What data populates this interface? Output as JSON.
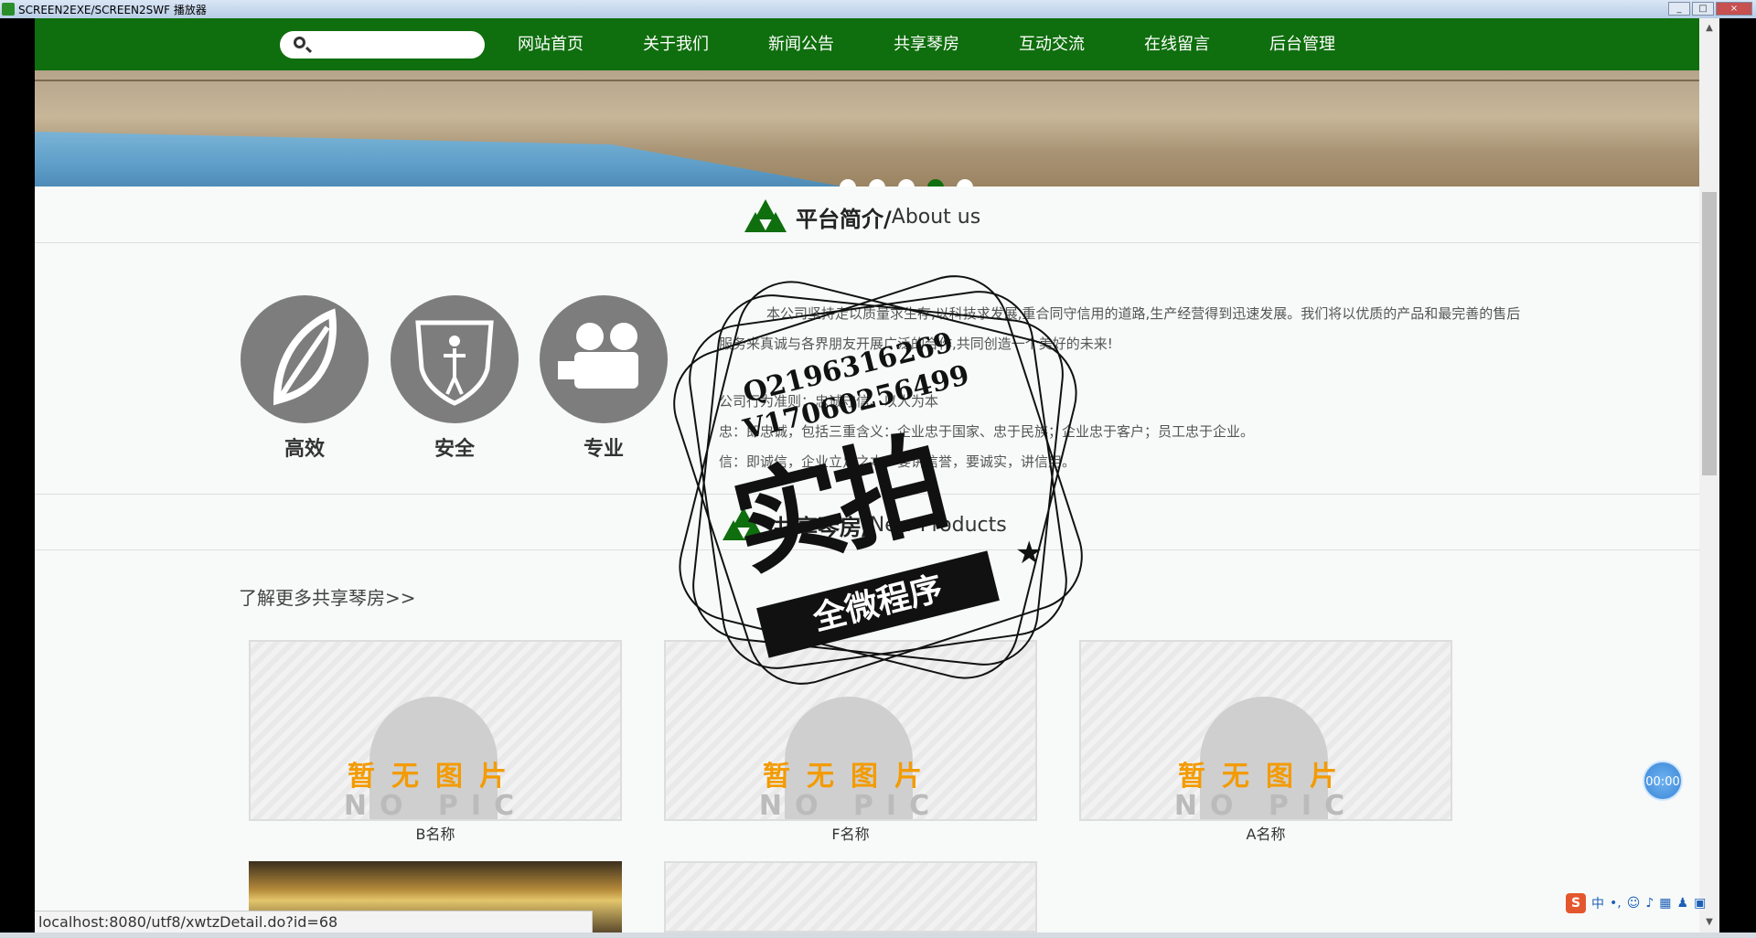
{
  "window": {
    "title": "SCREEN2EXE/SCREEN2SWF 播放器",
    "buttons": [
      "_",
      "□",
      "×"
    ]
  },
  "nav": {
    "search_placeholder": "",
    "items": [
      "网站首页",
      "关于我们",
      "新闻公告",
      "共享琴房",
      "互动交流",
      "在线留言",
      "后台管理"
    ]
  },
  "banner": {
    "slide_count": 5,
    "active_index": 3
  },
  "about": {
    "title_cn": "平台简介/",
    "title_en": "About us",
    "features": [
      {
        "label": "高效",
        "icon": "leaf-icon"
      },
      {
        "label": "安全",
        "icon": "shield-icon"
      },
      {
        "label": "专业",
        "icon": "video-camera-icon"
      }
    ],
    "paragraphs": [
      "本公司坚持走以质量求生存,以科技求发展,重合同守信用的道路,生产经营得到迅速发展。我们将以优质的产品和最完善的售后服务来真诚与各界朋友开展广泛的合作,共同创造一个美好的未来!",
      "公司行为准则：忠诚守信、以人为本",
      "忠：即忠诚，包括三重含义：企业忠于国家、忠于民族；企业忠于客户；员工忠于企业。",
      "信：即诚信，企业立足之本，要讲信誉，要诚实，讲信用。"
    ]
  },
  "products": {
    "title_cn": "共享琴房/",
    "title_en": "New Products",
    "more_link": "了解更多共享琴房>>",
    "cards": [
      {
        "name": "B名称",
        "img_cn": "暂无图片",
        "img_en": "NO PIC"
      },
      {
        "name": "F名称",
        "img_cn": "暂无图片",
        "img_en": "NO PIC"
      },
      {
        "name": "A名称",
        "img_cn": "暂无图片",
        "img_en": "NO PIC"
      }
    ]
  },
  "statusbar": {
    "url": "localhost:8080/utf8/xwtzDetail.do?id=68"
  },
  "timer": {
    "text": "00:00"
  },
  "ime": {
    "logo": "S",
    "lang": "中"
  },
  "watermark": {
    "line1": "Q2196316269",
    "line2": "V17060256499",
    "big": "实拍",
    "ribbon": "全微程序"
  }
}
